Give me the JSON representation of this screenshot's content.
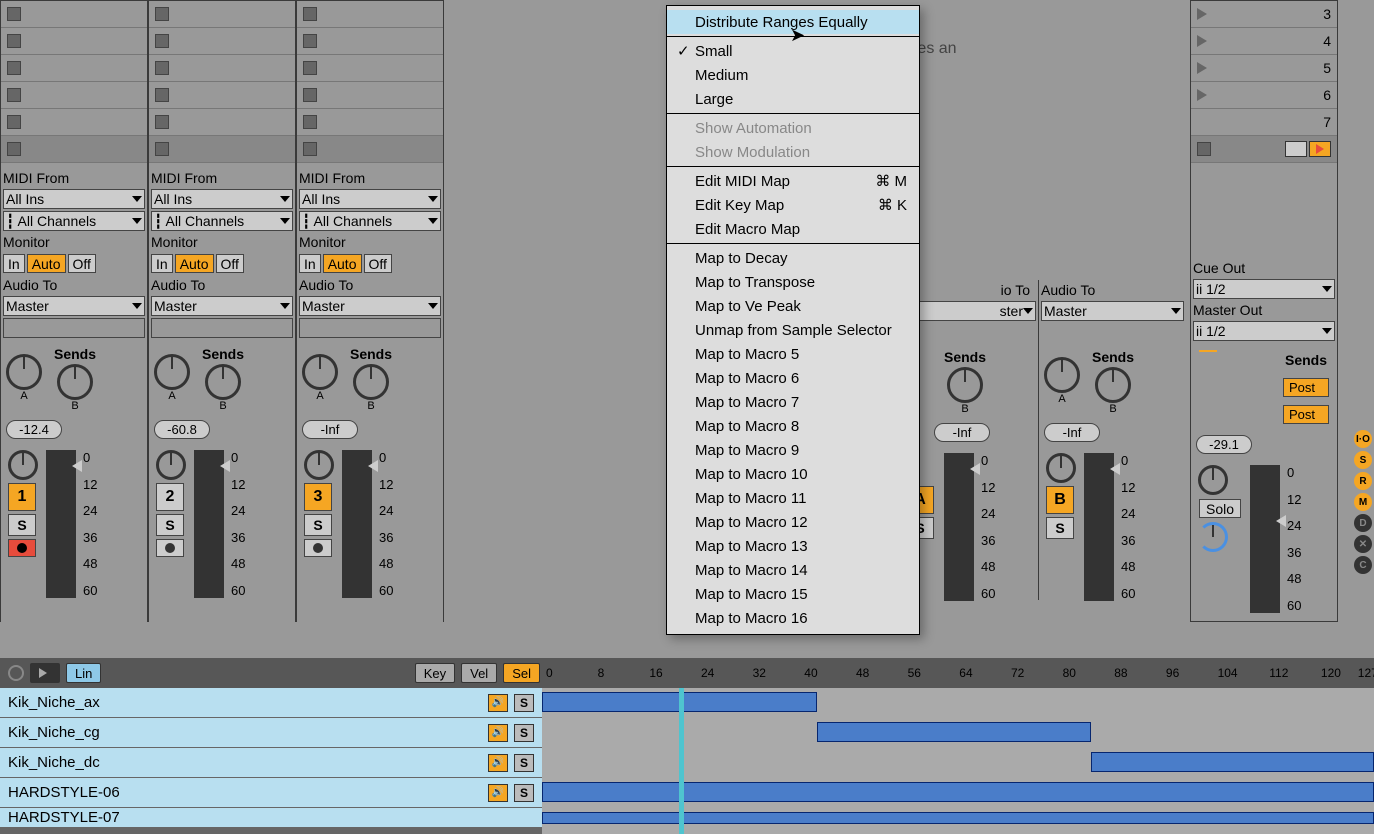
{
  "drop_text": "Drop Files an",
  "midi_from": "MIDI From",
  "all_ins": "All Ins",
  "all_channels": "All Channels",
  "monitor": "Monitor",
  "in": "In",
  "auto": "Auto",
  "off": "Off",
  "audio_to": "Audio To",
  "master": "Master",
  "sends": "Sends",
  "cue_out": "Cue Out",
  "master_out": "Master Out",
  "io12": "1/2",
  "tracks": [
    {
      "vol": "-12.4",
      "num": "1",
      "numActive": true,
      "recActive": true
    },
    {
      "vol": "-60.8",
      "num": "2",
      "numActive": false,
      "recActive": false
    },
    {
      "vol": "-Inf",
      "num": "3",
      "numActive": true,
      "recActive": false
    }
  ],
  "partial_tracks": [
    {
      "vol": "-Inf",
      "num": "A",
      "numActive": true
    },
    {
      "vol": "-Inf",
      "num": "B",
      "numActive": true
    }
  ],
  "master_vol": "-29.1",
  "fader_scale": [
    "0",
    "12",
    "24",
    "36",
    "48",
    "60"
  ],
  "clip_numbers": [
    "3",
    "4",
    "5",
    "6",
    "7"
  ],
  "menu": {
    "distribute": "Distribute Ranges Equally",
    "small": "Small",
    "medium": "Medium",
    "large": "Large",
    "show_auto": "Show Automation",
    "show_mod": "Show Modulation",
    "edit_midi": "Edit MIDI Map",
    "edit_midi_key": "⌘ M",
    "edit_key": "Edit Key Map",
    "edit_key_key": "⌘ K",
    "edit_macro": "Edit Macro Map",
    "map_decay": "Map to Decay",
    "map_transpose": "Map to Transpose",
    "map_vepeak": "Map to Ve Peak",
    "unmap": "Unmap from Sample Selector",
    "m5": "Map to Macro 5",
    "m6": "Map to Macro 6",
    "m7": "Map to Macro 7",
    "m8": "Map to Macro 8",
    "m9": "Map to Macro 9",
    "m10": "Map to Macro 10",
    "m11": "Map to Macro 11",
    "m12": "Map to Macro 12",
    "m13": "Map to Macro 13",
    "m14": "Map to Macro 14",
    "m15": "Map to Macro 15",
    "m16": "Map to Macro 16"
  },
  "bottom": {
    "key": "Key",
    "vel": "Vel",
    "sel": "Sel",
    "lin": "Lin",
    "samples": [
      "Kik_Niche_ax",
      "Kik_Niche_cg",
      "Kik_Niche_dc",
      "HARDSTYLE-06",
      "HARDSTYLE-07"
    ],
    "ruler": [
      "0",
      "8",
      "16",
      "24",
      "32",
      "40",
      "48",
      "56",
      "64",
      "72",
      "80",
      "88",
      "96",
      "104",
      "112",
      "120",
      "127"
    ]
  },
  "post": "Post",
  "solo": "Solo",
  "io_label": "io To"
}
